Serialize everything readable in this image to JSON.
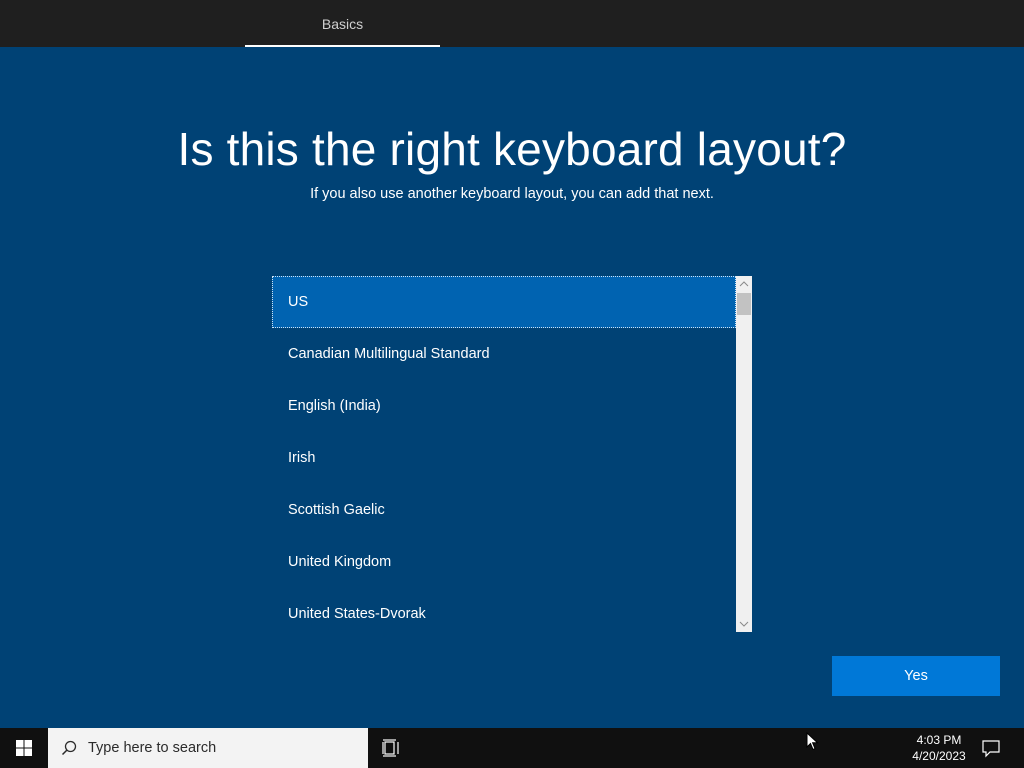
{
  "header": {
    "tab_label": "Basics"
  },
  "page": {
    "title": "Is this the right keyboard layout?",
    "subtitle": "If you also use another keyboard layout, you can add that next."
  },
  "layout_list": {
    "items": [
      "US",
      "Canadian Multilingual Standard",
      "English (India)",
      "Irish",
      "Scottish Gaelic",
      "United Kingdom",
      "United States-Dvorak"
    ],
    "selected_index": 0
  },
  "actions": {
    "yes_label": "Yes"
  },
  "taskbar": {
    "search_placeholder": "Type here to search",
    "time": "4:03 PM",
    "date": "4/20/2023"
  },
  "colors": {
    "background": "#004275",
    "selected_item": "#0063b1",
    "primary_button": "#0078d7",
    "taskbar": "#101010"
  },
  "icons": {
    "start": "windows-logo-icon",
    "search": "magnifier-icon",
    "task_view": "task-view-icon",
    "notifications": "action-center-icon",
    "pointer": "mouse-pointer-icon"
  }
}
